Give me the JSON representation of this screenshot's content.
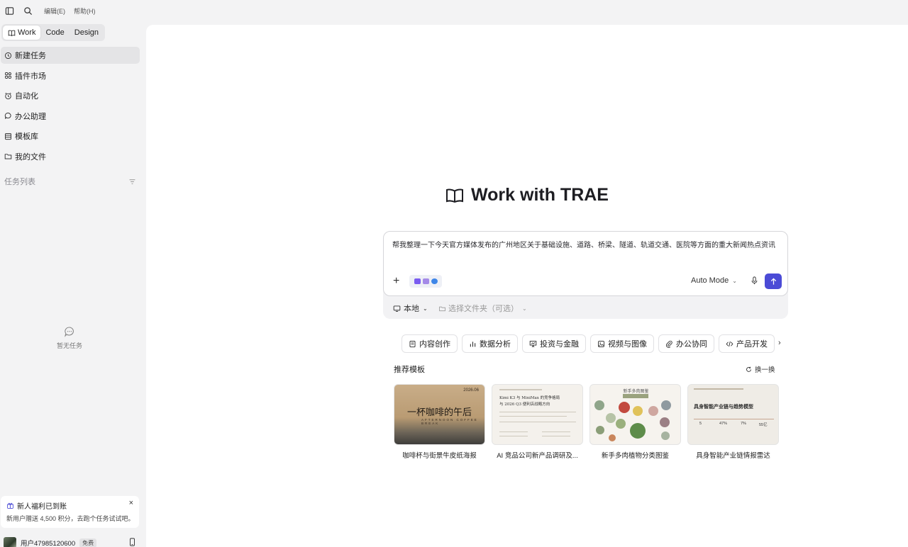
{
  "menu": {
    "edit": "编辑(E)",
    "help": "帮助(H)"
  },
  "sidebar": {
    "modes": [
      "Work",
      "Code",
      "Design"
    ],
    "items": [
      {
        "label": "新建任务",
        "icon": "new-task-icon"
      },
      {
        "label": "插件市场",
        "icon": "plugin-grid-icon"
      },
      {
        "label": "自动化",
        "icon": "alarm-clock-icon"
      },
      {
        "label": "办公助理",
        "icon": "chat-bubble-icon"
      },
      {
        "label": "模板库",
        "icon": "template-icon"
      },
      {
        "label": "我的文件",
        "icon": "folder-icon"
      }
    ],
    "task_list_title": "任务列表",
    "empty_text": "暂无任务",
    "promo": {
      "title": "新人福利已到账",
      "desc": "新用户赠送 4,500 积分，去跑个任务试试吧。",
      "close": "×"
    },
    "user": {
      "name": "用户47985120600",
      "plan": "免费"
    }
  },
  "main": {
    "hero_title": "Work with TRAE",
    "prompt": "帮我整理一下今天官方媒体发布的广州地区关于基础设施、道路、桥梁、隧道、轨道交通、医院等方面的重大新闻热点资讯",
    "add": "+",
    "mode": "Auto Mode",
    "location": "本地",
    "folder_placeholder": "选择文件夹（可选）",
    "categories": [
      {
        "label": "内容创作",
        "icon": "document-icon"
      },
      {
        "label": "数据分析",
        "icon": "bar-chart-icon"
      },
      {
        "label": "投资与金融",
        "icon": "presentation-icon"
      },
      {
        "label": "视频与图像",
        "icon": "image-icon"
      },
      {
        "label": "办公协同",
        "icon": "clip-icon"
      },
      {
        "label": "产品开发",
        "icon": "code-icon"
      }
    ],
    "more": "›",
    "recommend_title": "推荐模板",
    "refresh": "换一换",
    "templates": [
      {
        "label": "咖啡杯与街景牛皮纸海报",
        "thumb_title": "一杯咖啡的午后",
        "thumb_date": "2026.06",
        "thumb_sub": "AFTERNOON COFFEE BREAK"
      },
      {
        "label": "AI 竞品公司新产品调研及...",
        "thumb_title": "Kimi K3 与 MiniMax 的竞争格局",
        "thumb_sub": "与 2026 Q3 便利店战略方向"
      },
      {
        "label": "新手多肉植物分类图鉴",
        "thumb_title": "新手多肉图鉴"
      },
      {
        "label": "具身智能产业链情报雷达",
        "thumb_title": "具身智能产业链与趋势模型",
        "thumb_numbers": [
          "5",
          "47%",
          "7%",
          "55亿"
        ]
      }
    ]
  },
  "colors": {
    "accent": "#4b4bd6",
    "sidebar_bg": "#f3f3f4",
    "main_bg": "#ffffff"
  }
}
